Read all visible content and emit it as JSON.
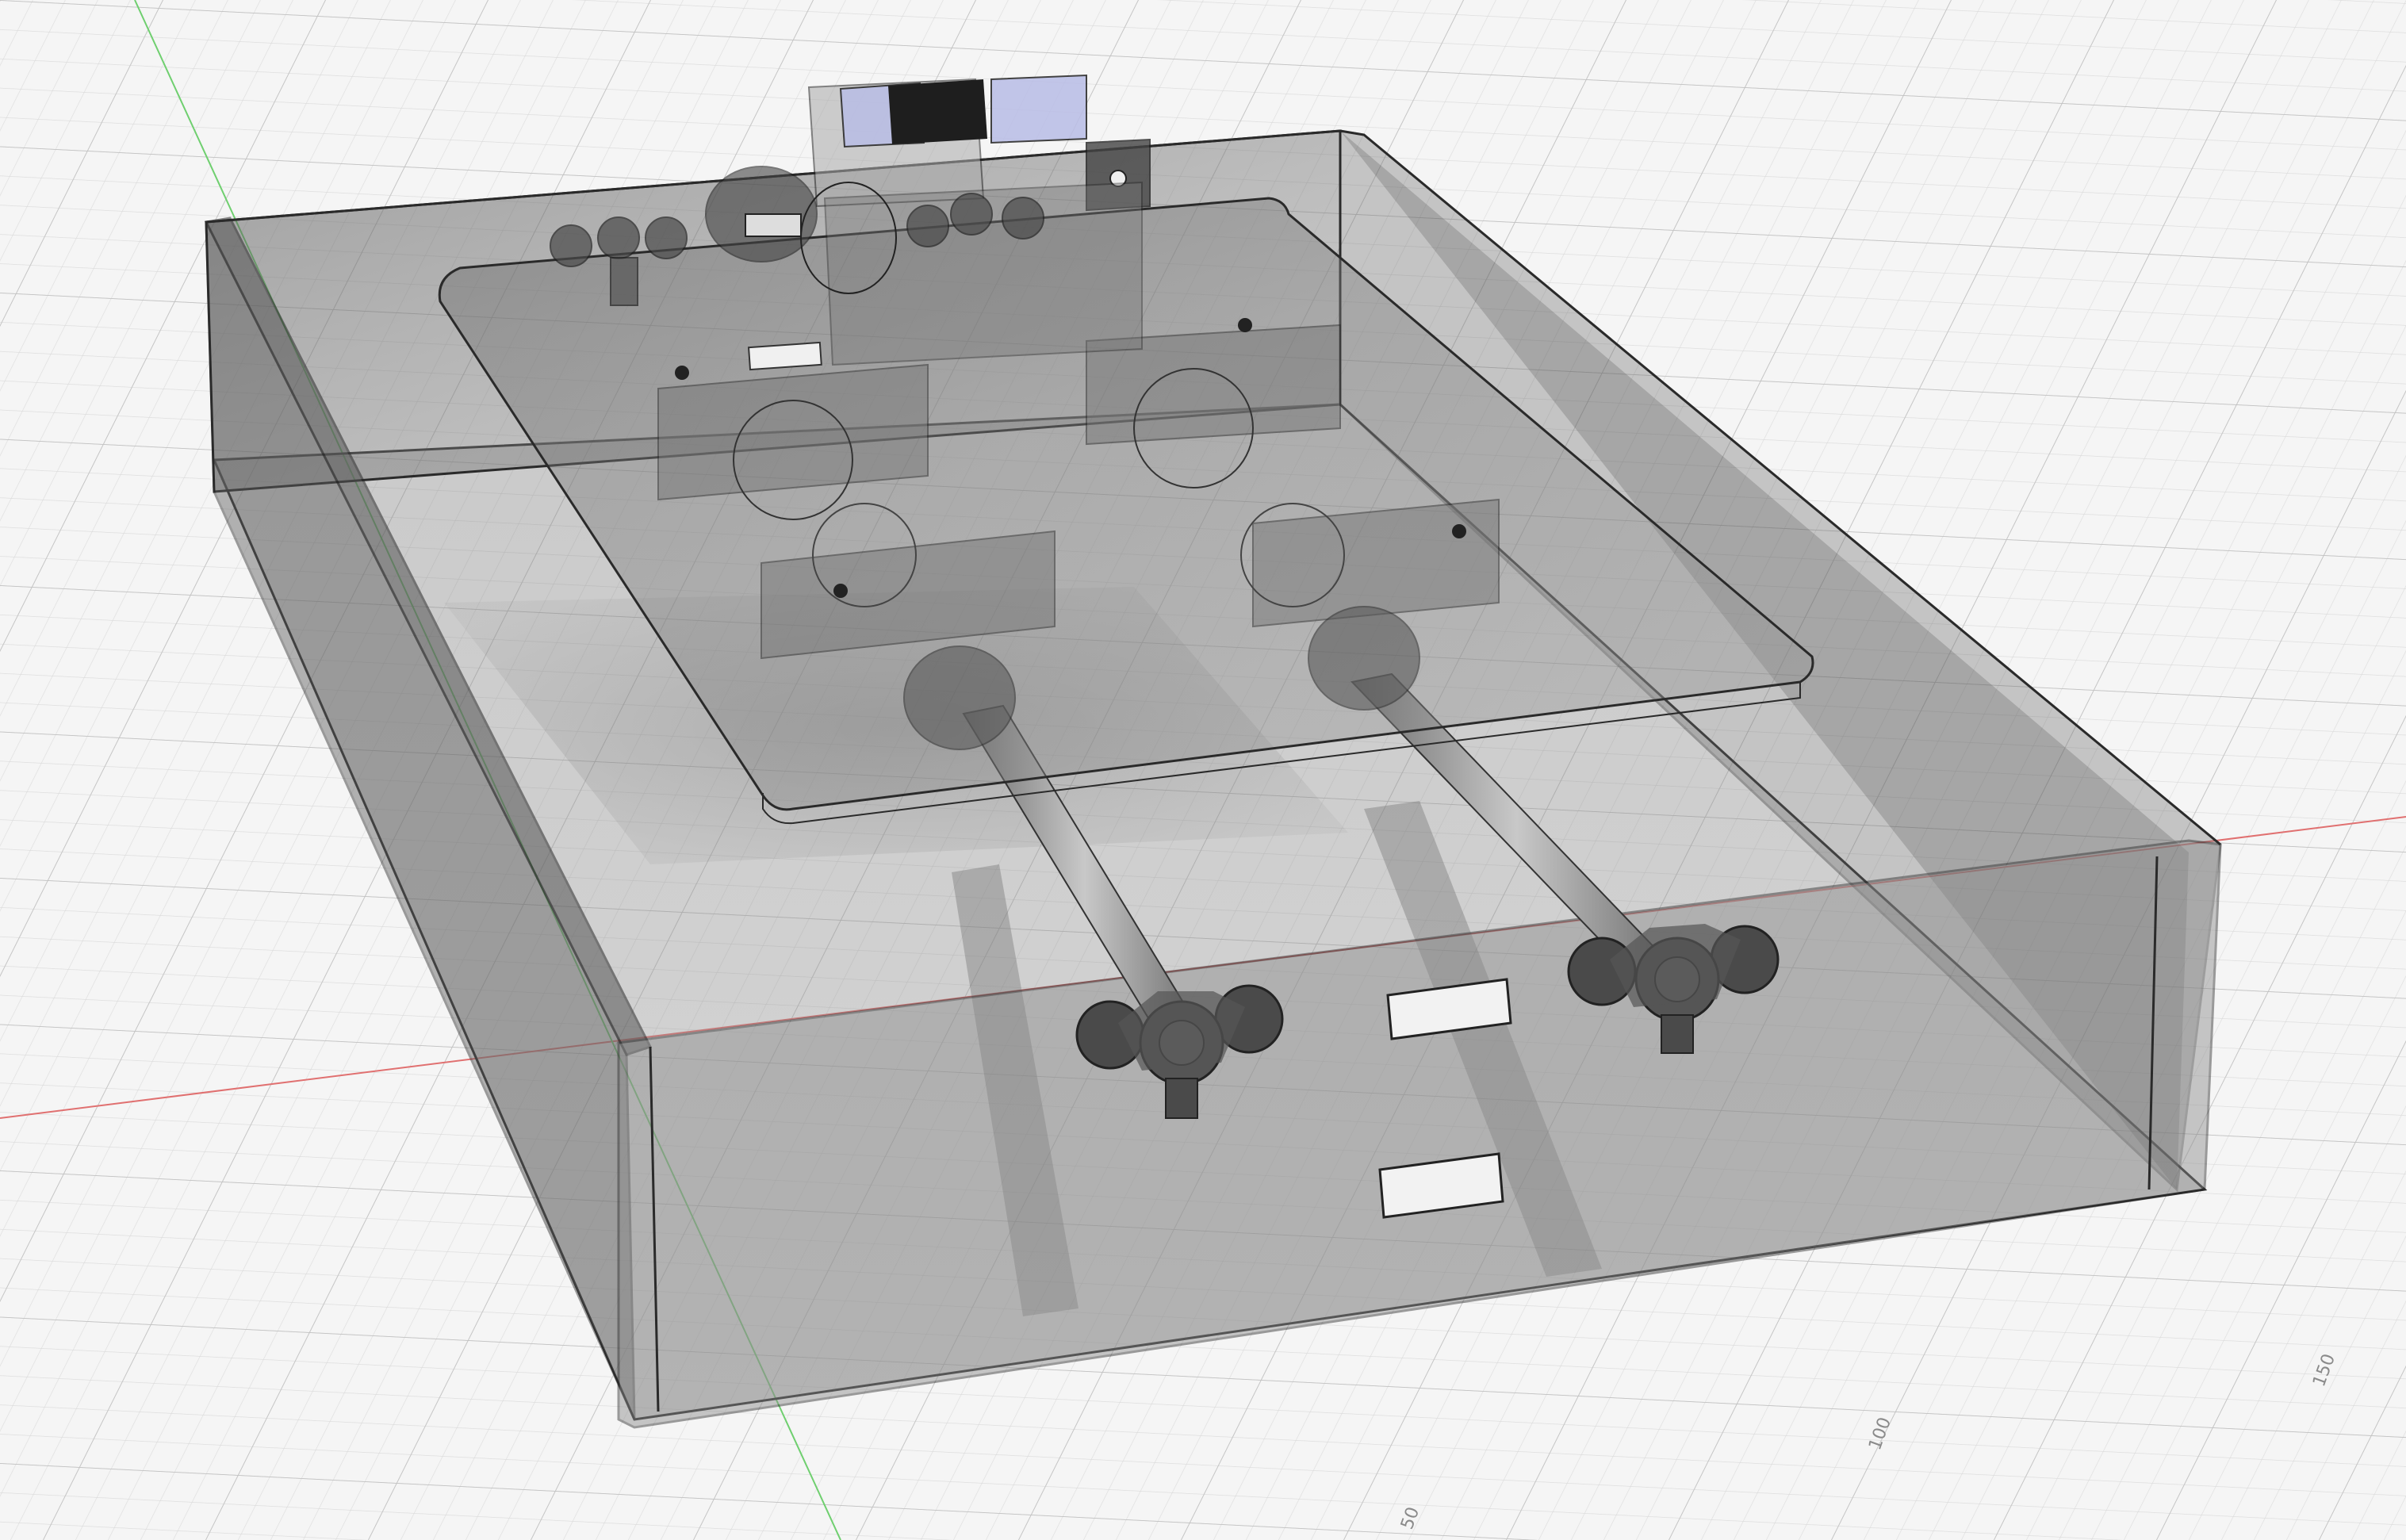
{
  "viewport": {
    "background": "#f5f5f5",
    "grid_minor_color": "#dcdcdc",
    "grid_major_color": "#c4c4c4",
    "axis_x_color": "#e07070",
    "axis_y_color": "#6fcf6f"
  },
  "rulers": {
    "label_50": "50",
    "label_100": "100",
    "label_150": "150"
  },
  "model": {
    "enclosure_fill": "#6e6e6e",
    "enclosure_edge": "#2a2a2a",
    "plate_fill": "#8c8c8c",
    "part_color": "#4a4a4a",
    "motor_highlight": "#b9bde6",
    "motor_body": "#1e1e1e",
    "rod_color": "#9a9a9a"
  }
}
